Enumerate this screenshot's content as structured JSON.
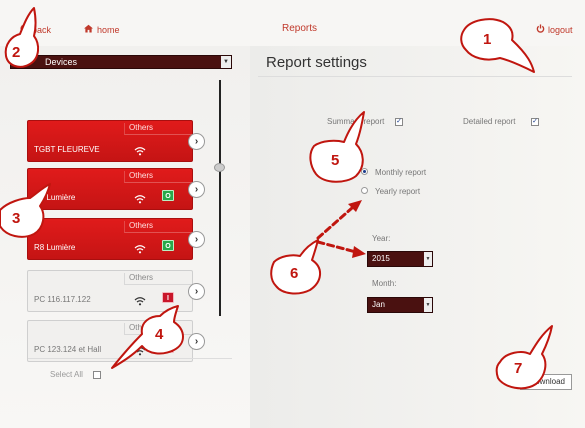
{
  "topbar": {
    "back_label": "back",
    "home_label": "home",
    "title": "Reports",
    "logout_label": "logout"
  },
  "devices": {
    "selector_value": "Devices",
    "cards": [
      {
        "category": "Others",
        "name": "TGBT FLEUREVE",
        "style": "red",
        "badge": "",
        "badge_color": ""
      },
      {
        "category": "Others",
        "name": "R4 Lumière",
        "style": "red",
        "badge": "O",
        "badge_color": "#2aa84a"
      },
      {
        "category": "Others",
        "name": "R8 Lumière",
        "style": "red",
        "badge": "O",
        "badge_color": "#2aa84a"
      },
      {
        "category": "Others",
        "name": "PC 116.117.122",
        "style": "grey",
        "badge": "I",
        "badge_color": "#c9162a"
      },
      {
        "category": "Others",
        "name": "PC 123.124 et Hall",
        "style": "grey",
        "badge": "I",
        "badge_color": "#c9162a"
      }
    ],
    "select_all_label": "Select All"
  },
  "report_settings": {
    "title": "Report settings",
    "summary_label": "Summary report",
    "summary_checked": true,
    "detailed_label": "Detailed report",
    "detailed_checked": true,
    "monthly_label": "Monthly report",
    "yearly_label": "Yearly report",
    "selected_period": "Monthly report",
    "year_label": "Year:",
    "year_value": "2015",
    "month_label": "Month:",
    "month_value": "Jan",
    "download_label": "Download"
  },
  "annotations": [
    "1",
    "2",
    "3",
    "4",
    "5",
    "6",
    "7"
  ],
  "colors": {
    "accent_red": "#e01b1b",
    "dark_maroon": "#4a1110",
    "annotation_red": "#c0160f",
    "link_red": "#c0392b"
  }
}
